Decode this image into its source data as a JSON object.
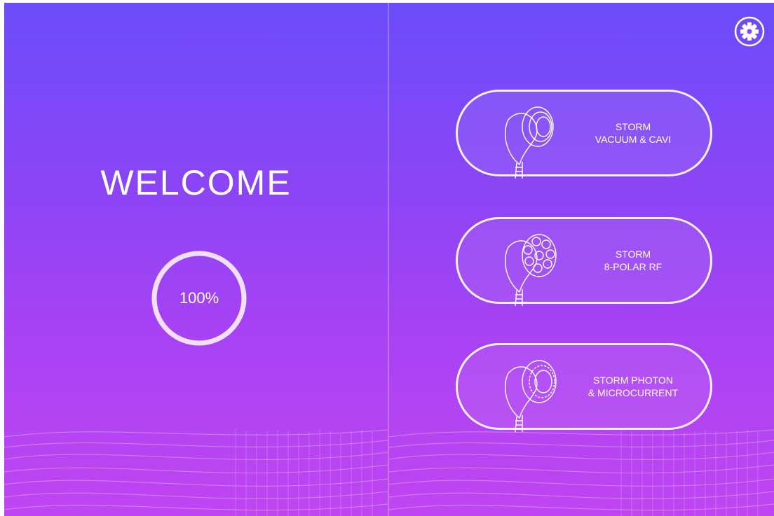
{
  "welcome": {
    "title": "WELCOME"
  },
  "loading": {
    "percent_text": "100%",
    "progress": 1.0
  },
  "settings": {
    "icon": "gear-icon"
  },
  "modes": [
    {
      "label": "STORM\nVACUUM & CAVI",
      "icon": "vacuum-handpiece-icon"
    },
    {
      "label": "STORM\n8-POLAR RF",
      "icon": "rf-handpiece-icon"
    },
    {
      "label": "STORM PHOTON\n& MICROCURRENT",
      "icon": "photon-handpiece-icon"
    }
  ],
  "colors": {
    "gradient_top": "#6c4cfb",
    "gradient_bottom": "#c045f2",
    "outline": "#ffffff"
  }
}
